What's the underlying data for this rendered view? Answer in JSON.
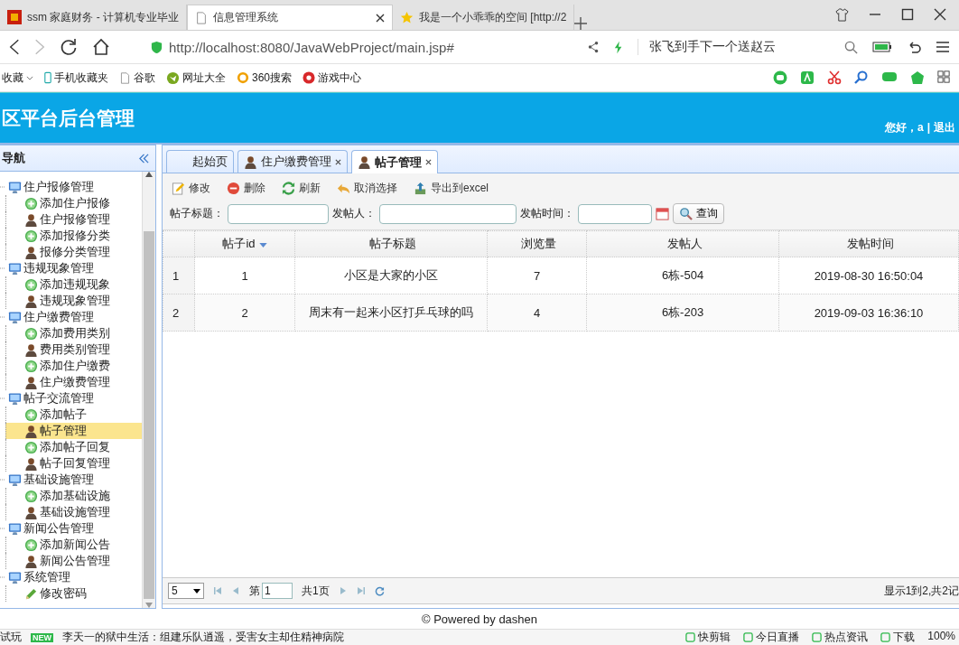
{
  "browser": {
    "tabs": [
      {
        "title": "ssm 家庭财务 - 计算机专业毕业",
        "kind": "app",
        "selected": false
      },
      {
        "title": "信息管理系统",
        "kind": "page",
        "selected": true
      },
      {
        "title": "我是一个小乖乖的空间 [http://2",
        "kind": "star",
        "selected": false
      }
    ],
    "address": "http://localhost:8080/JavaWebProject/main.jsp#",
    "search": "张飞到手下一个送赵云",
    "bookmarks": [
      {
        "label": "收藏",
        "kind": "menu"
      },
      {
        "label": "手机收藏夹",
        "kind": "phone"
      },
      {
        "label": "谷歌",
        "kind": "page"
      },
      {
        "label": "网址大全",
        "kind": "globe"
      },
      {
        "label": "360搜索",
        "kind": "ring"
      },
      {
        "label": "游戏中心",
        "kind": "game"
      }
    ]
  },
  "header": {
    "title": "区平台后台管理",
    "greeting": "您好，a",
    "separator": "|",
    "logout": "退出"
  },
  "sidebar": {
    "title": "导航",
    "groups": [
      {
        "label": "住户报修管理",
        "children": [
          {
            "label": "添加住户报修",
            "kind": "add",
            "selected": false
          },
          {
            "label": "住户报修管理",
            "kind": "manage",
            "selected": false
          },
          {
            "label": "添加报修分类",
            "kind": "add",
            "selected": false
          },
          {
            "label": "报修分类管理",
            "kind": "manage",
            "selected": false
          }
        ]
      },
      {
        "label": "违规现象管理",
        "children": [
          {
            "label": "添加违规现象",
            "kind": "add",
            "selected": false
          },
          {
            "label": "违规现象管理",
            "kind": "manage",
            "selected": false
          }
        ]
      },
      {
        "label": "住户缴费管理",
        "children": [
          {
            "label": "添加费用类别",
            "kind": "add",
            "selected": false
          },
          {
            "label": "费用类别管理",
            "kind": "manage",
            "selected": false
          },
          {
            "label": "添加住户缴费",
            "kind": "add",
            "selected": false
          },
          {
            "label": "住户缴费管理",
            "kind": "manage",
            "selected": false
          }
        ]
      },
      {
        "label": "帖子交流管理",
        "children": [
          {
            "label": "添加帖子",
            "kind": "add",
            "selected": false
          },
          {
            "label": "帖子管理",
            "kind": "manage",
            "selected": true
          },
          {
            "label": "添加帖子回复",
            "kind": "add",
            "selected": false
          },
          {
            "label": "帖子回复管理",
            "kind": "manage",
            "selected": false
          }
        ]
      },
      {
        "label": "基础设施管理",
        "children": [
          {
            "label": "添加基础设施",
            "kind": "add",
            "selected": false
          },
          {
            "label": "基础设施管理",
            "kind": "manage",
            "selected": false
          }
        ]
      },
      {
        "label": "新闻公告管理",
        "children": [
          {
            "label": "添加新闻公告",
            "kind": "add",
            "selected": false
          },
          {
            "label": "新闻公告管理",
            "kind": "manage",
            "selected": false
          }
        ]
      },
      {
        "label": "系统管理",
        "children": [
          {
            "label": "修改密码",
            "kind": "password",
            "selected": false
          }
        ]
      }
    ]
  },
  "content_tabs": [
    {
      "label": "起始页",
      "closable": false,
      "selected": false
    },
    {
      "label": "住户缴费管理",
      "closable": true,
      "selected": false
    },
    {
      "label": "帖子管理",
      "closable": true,
      "selected": true
    }
  ],
  "toolbar": [
    {
      "label": "修改",
      "kind": "edit"
    },
    {
      "label": "删除",
      "kind": "delete"
    },
    {
      "label": "刷新",
      "kind": "refresh"
    },
    {
      "label": "取消选择",
      "kind": "undo"
    },
    {
      "label": "导出到excel",
      "kind": "export"
    }
  ],
  "filters": [
    {
      "label": "帖子标题：",
      "kind": "text"
    },
    {
      "label": "发帖人：",
      "kind": "text"
    },
    {
      "label": "发帖时间：",
      "kind": "date"
    }
  ],
  "search_button": "查询",
  "table": {
    "columns": [
      {
        "label": "帖子id",
        "sorted": true
      },
      {
        "label": "帖子标题",
        "sorted": false
      },
      {
        "label": "浏览量",
        "sorted": false
      },
      {
        "label": "发帖人",
        "sorted": false
      },
      {
        "label": "发帖时间",
        "sorted": false
      }
    ],
    "rows": [
      {
        "number": "1",
        "cells": [
          "1",
          "小区是大家的小区",
          "7",
          "6栋-504",
          "2019-08-30 16:50:04"
        ]
      },
      {
        "number": "2",
        "cells": [
          "2",
          "周末有一起来小区打乒乓球的吗",
          "4",
          "6栋-203",
          "2019-09-03 16:36:10"
        ]
      }
    ]
  },
  "pager": {
    "page_size": "5",
    "page_prefix": "第",
    "page": "1",
    "page_total": "共1页",
    "info": "显示1到2,共2记"
  },
  "footer": "© Powered by dashen",
  "status_bar": {
    "left": "试玩",
    "badge": "NEW",
    "news": "李天一的狱中生活：组建乐队逍遥，受害女主却住精神病院",
    "items": [
      "快剪辑",
      "今日直播",
      "热点资讯",
      "下载"
    ],
    "zoom": "100%"
  }
}
